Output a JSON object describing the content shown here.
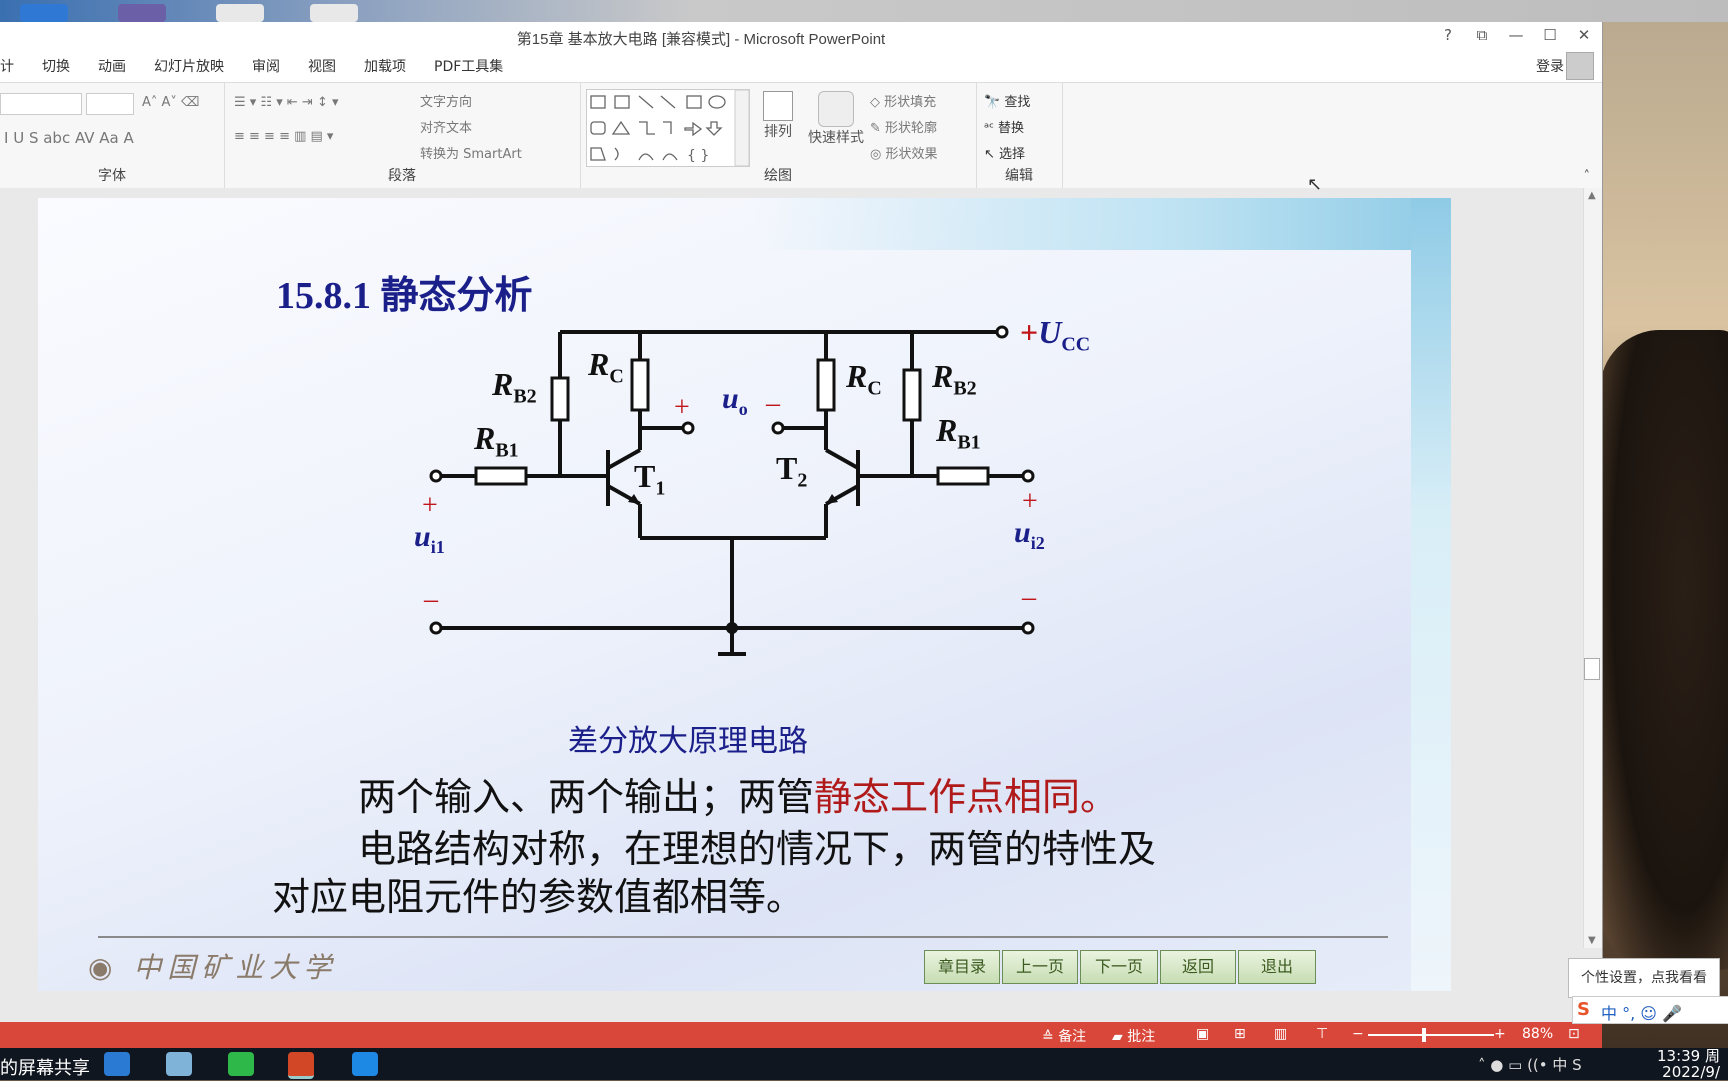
{
  "window": {
    "title": "第15章  基本放大电路 [兼容模式] - Microsoft PowerPoint",
    "controls": [
      "?",
      "⧉",
      "—",
      "☐",
      "✕"
    ]
  },
  "tabs": [
    "计",
    "切换",
    "动画",
    "幻灯片放映",
    "审阅",
    "视图",
    "加载项",
    "PDF工具集"
  ],
  "login": "登录",
  "ribbon": {
    "font_group": "字体",
    "paragraph_group": "段落",
    "drawing_group": "绘图",
    "editing_group": "编辑",
    "text_direction": "文字方向",
    "align_text": "对齐文本",
    "convert_smartart": "转换为 SmartArt",
    "arrange": "排列",
    "quick_styles": "快速样式",
    "shape_fill": "形状填充",
    "shape_outline": "形状轮廓",
    "shape_effects": "形状效果",
    "find": "查找",
    "replace": "替换",
    "select": "选择"
  },
  "slide": {
    "title": "15.8.1  静态分析",
    "circuit_labels": {
      "rb2_left": "R",
      "rb2_left_sub": "B2",
      "rc_left": "R",
      "rc_left_sub": "C",
      "rb1_left": "R",
      "rb1_left_sub": "B1",
      "t1": "T",
      "t1_sub": "1",
      "t2": "T",
      "t2_sub": "2",
      "rc_right": "R",
      "rc_right_sub": "C",
      "rb2_right": "R",
      "rb2_right_sub": "B2",
      "rb1_right": "R",
      "rb1_right_sub": "B1",
      "ucc_plus": "+",
      "ucc": "U",
      "ucc_sub": "CC",
      "uo": "u",
      "uo_sub": "o",
      "uo_plus": "+",
      "uo_minus": "–",
      "ui1": "u",
      "ui1_sub": "i1",
      "ui2": "u",
      "ui2_sub": "i2",
      "plus_left": "+",
      "minus_left": "–",
      "plus_right": "+",
      "minus_right": "–"
    },
    "caption": "差分放大原理电路",
    "line1_a": "两个输入、两个输出；两管",
    "line1_b": "静态工作点相同。",
    "line2": "电路结构对称，在理想的情况下，两管的特性及",
    "line3": "对应电阻元件的参数值都相等。",
    "logo_text": "中国矿业大学",
    "nav": [
      "章目录",
      "上一页",
      "下一页",
      "返回",
      "退出"
    ]
  },
  "statusbar": {
    "notes": "备注",
    "comments": "批注",
    "zoom": "88%"
  },
  "taskbar": {
    "share_text": "的屏幕共享",
    "time": "13:39 周",
    "date": "2022/9/"
  },
  "tooltip": "个性设置，点我看看",
  "ime": "中 °, ☺ 🎤"
}
